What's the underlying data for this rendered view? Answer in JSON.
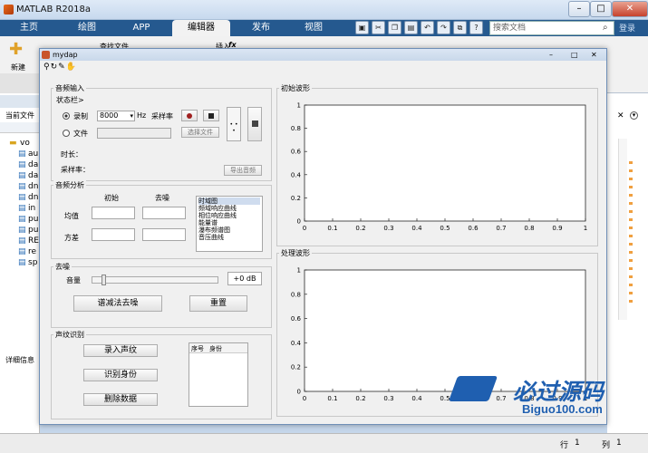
{
  "app": {
    "title": "MATLAB R2018a",
    "win_buttons": [
      "–",
      "□",
      "✕"
    ]
  },
  "ribbon": {
    "tabs": [
      "主页",
      "绘图",
      "APP",
      "编辑器",
      "发布",
      "视图"
    ]
  },
  "toolstrip": {
    "new_label": "新建",
    "open_file": "查找文件",
    "insert": "插入",
    "fx": "fx"
  },
  "search": {
    "placeholder": "搜索文档"
  },
  "login": "登录",
  "left_panel": {
    "current_folder": "当前文件",
    "details": "详细信息",
    "files": [
      "vo",
      "au",
      "da",
      "da",
      "dn",
      "dn",
      "in",
      "pu",
      "pu",
      "RE",
      "re",
      "sp"
    ]
  },
  "status": {
    "row": "行",
    "row_val": "1",
    "col": "列",
    "col_val": "1"
  },
  "figure": {
    "title": "mydap",
    "audio_input": {
      "title": "音频输入",
      "status": "状态栏>",
      "record": "录制",
      "rate_value": "8000",
      "hz": "Hz",
      "rate_label": "采样率",
      "file": "文件",
      "choose_file": "选择文件",
      "duration": "时长：",
      "samplerate": "采样率：",
      "export": "导出音频",
      "dots": "• • •"
    },
    "analysis": {
      "title": "音频分析",
      "col_initial": "初始",
      "col_denoise": "去噪",
      "mean": "均值",
      "variance": "方差",
      "list": [
        "时域图",
        "频域响应曲线",
        "相位响应曲线",
        "能量谱",
        "瀑布频谱图",
        "音压曲线"
      ]
    },
    "denoise": {
      "title": "去噪",
      "volume": "音量",
      "db_value": "+0 dB",
      "spectral": "谱减法去噪",
      "reset": "重置"
    },
    "voiceprint": {
      "title": "声纹识别",
      "enroll": "录入声纹",
      "identify": "识别身份",
      "delete": "删除数据",
      "col_no": "序号",
      "col_id": "身份"
    },
    "plot1": {
      "title": "初始波形"
    },
    "plot2": {
      "title": "处理波形"
    }
  },
  "watermark": {
    "cn": "必过源码",
    "en": "Biguo100.com"
  },
  "chart_data": [
    {
      "type": "line",
      "title": "初始波形",
      "xlim": [
        0,
        1
      ],
      "ylim": [
        0,
        1
      ],
      "xticks": [
        "0",
        "0.1",
        "0.2",
        "0.3",
        "0.4",
        "0.5",
        "0.6",
        "0.7",
        "0.8",
        "0.9",
        "1"
      ],
      "yticks": [
        "0",
        "0.2",
        "0.4",
        "0.6",
        "0.8",
        "1"
      ],
      "series": []
    },
    {
      "type": "line",
      "title": "处理波形",
      "xlim": [
        0,
        1
      ],
      "ylim": [
        0,
        1
      ],
      "xticks": [
        "0",
        "0.1",
        "0.2",
        "0.3",
        "0.4",
        "0.5",
        "0.6",
        "0.7",
        "0.8",
        "0.9",
        "1"
      ],
      "yticks": [
        "0",
        "0.2",
        "0.4",
        "0.6",
        "0.8",
        "1"
      ],
      "series": []
    }
  ]
}
